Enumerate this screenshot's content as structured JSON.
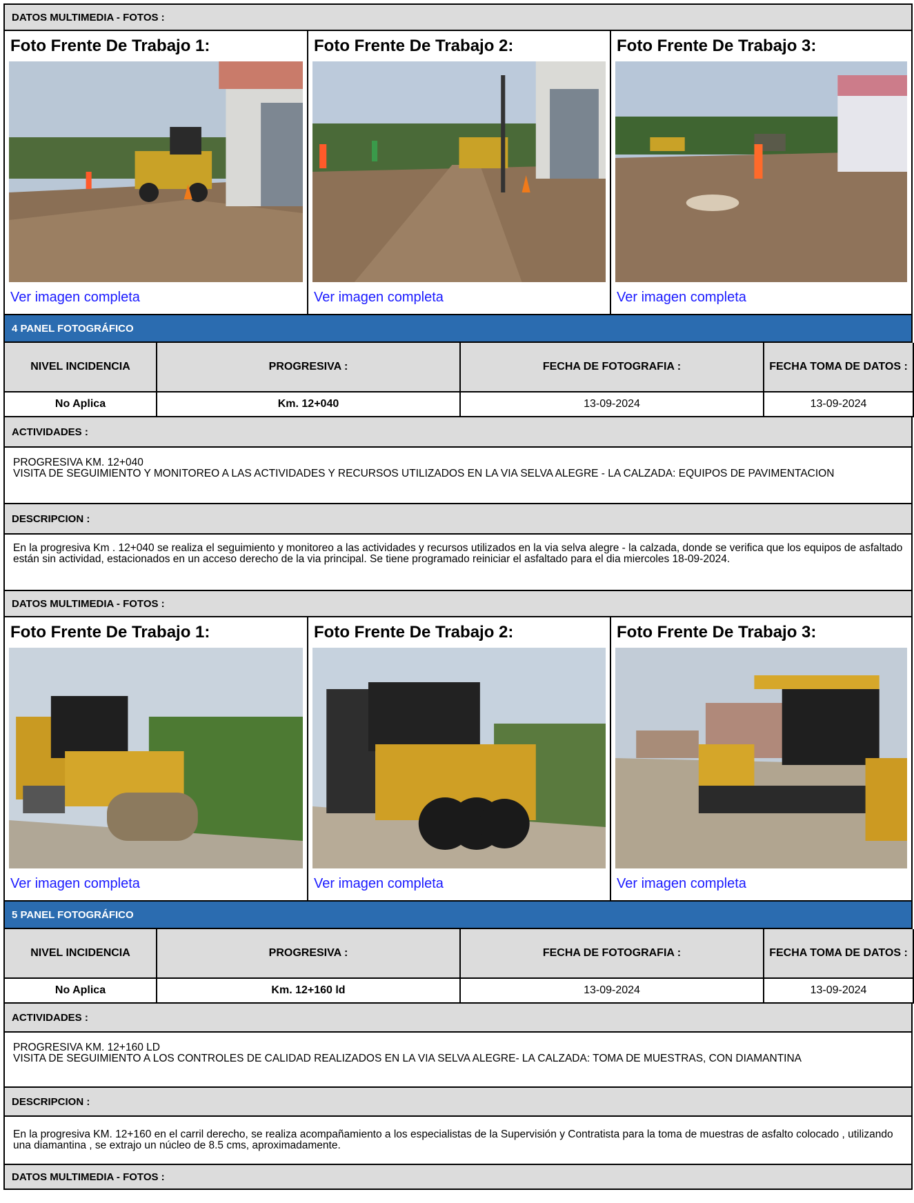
{
  "sections": {
    "multimedia_label": "DATOS MULTIMEDIA - FOTOS :",
    "activities_label": "ACTIVIDADES :",
    "description_label": "DESCRIPCION :"
  },
  "photo_titles": [
    "Foto Frente De Trabajo 1:",
    "Foto Frente De Trabajo 2:",
    "Foto Frente De Trabajo 3:"
  ],
  "photo_link": "Ver imagen completa",
  "table_headers": {
    "nivel": "NIVEL INCIDENCIA",
    "progresiva": "PROGRESIVA :",
    "fecha_foto": "FECHA DE FOTOGRAFIA :",
    "fecha_toma": "FECHA TOMA DE DATOS :"
  },
  "panels": [
    {
      "title": "4 PANEL FOTOGRÁFICO",
      "nivel": "No Aplica",
      "progresiva": "Km. 12+040",
      "fecha_foto": "13-09-2024",
      "fecha_toma": "13-09-2024",
      "actividades_l1": "PROGRESIVA KM. 12+040",
      "actividades_l2": "VISITA DE SEGUIMIENTO Y MONITOREO A LAS ACTIVIDADES Y RECURSOS UTILIZADOS EN LA VIA SELVA ALEGRE - LA CALZADA: EQUIPOS DE PAVIMENTACION",
      "descripcion": "En la progresiva Km . 12+040 se realiza el seguimiento y monitoreo a las actividades y recursos utilizados en la via selva alegre - la calzada, donde se verifica que los equipos de asfaltado están sin actividad, estacionados en un acceso derecho de la via principal. Se tiene programado reiniciar el asfaltado para el dia miercoles 18-09-2024."
    },
    {
      "title": "5 PANEL FOTOGRÁFICO",
      "nivel": "No Aplica",
      "progresiva": "Km. 12+160 ld",
      "fecha_foto": "13-09-2024",
      "fecha_toma": "13-09-2024",
      "actividades_l1": "PROGRESIVA KM. 12+160 LD",
      "actividades_l2": "VISITA DE SEGUIMIENTO A LOS CONTROLES DE CALIDAD REALIZADOS EN LA VIA SELVA ALEGRE- LA CALZADA: TOMA DE MUESTRAS, CON DIAMANTINA",
      "descripcion": "En la progresiva KM. 12+160 en el carril  derecho, se realiza acompañamiento a los especialistas de la Supervisión y Contratista para la toma de muestras de asfalto colocado , utilizando una diamantina , se extrajo un núcleo de 8.5 cms, aproximadamente."
    }
  ],
  "colors": {
    "header_gray": "#dcdcdc",
    "panel_blue": "#2b6cb0",
    "link_blue": "#1a1aff"
  }
}
